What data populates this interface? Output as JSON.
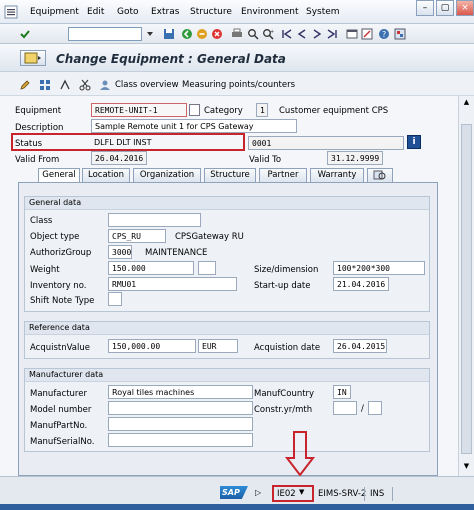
{
  "menu": {
    "items": [
      "Equipment",
      "Edit",
      "Goto",
      "Extras",
      "Structure",
      "Environment",
      "System"
    ],
    "window_buttons": {
      "minimize": "–",
      "maximize": "▢",
      "close": "×"
    }
  },
  "toolbar": {
    "command_field": {
      "value": ""
    },
    "icons": [
      "enter-icon",
      "command-dropdown-icon",
      "save-icon",
      "back-icon",
      "exit-icon",
      "cancel-icon",
      "print-icon",
      "find-icon",
      "find-next-icon",
      "first-page-icon",
      "prev-page-icon",
      "next-page-icon",
      "last-page-icon",
      "create-session-icon",
      "shortcut-icon",
      "help-icon",
      "layout-icon"
    ]
  },
  "title": {
    "text": "Change Equipment : General Data"
  },
  "appbar": {
    "class_overview": "Class overview",
    "measuring_points": "Measuring points/counters"
  },
  "header": {
    "equipment_label": "Equipment",
    "equipment_value": "REMOTE-UNIT-1",
    "category_label": "Category",
    "category_value": "1",
    "category_text": "Customer equipment CPS",
    "description_label": "Description",
    "description_value": "Sample Remote unit 1 for CPS Gateway",
    "status_label": "Status",
    "status_value": "DLFL DLT  INST",
    "status_extra": "0001",
    "valid_from_label": "Valid From",
    "valid_from_value": "26.04.2016",
    "valid_to_label": "Valid To",
    "valid_to_value": "31.12.9999"
  },
  "tabs": [
    "General",
    "Location",
    "Organization",
    "Structure",
    "Partner",
    "Warranty"
  ],
  "general_data": {
    "title": "General data",
    "class_label": "Class",
    "class_value": "",
    "object_type_label": "Object type",
    "object_type_value": "CPS_RU",
    "object_type_text": "CPSGateway RU",
    "authoriz_label": "AuthorizGroup",
    "authoriz_value": "3000",
    "authoriz_text": "MAINTENANCE",
    "weight_label": "Weight",
    "weight_value": "150.000",
    "size_label": "Size/dimension",
    "size_value": "100*200*300",
    "inventory_label": "Inventory no.",
    "inventory_value": "RMU01",
    "startup_label": "Start-up date",
    "startup_value": "21.04.2016",
    "shift_label": "Shift Note Type"
  },
  "reference_data": {
    "title": "Reference data",
    "acq_value_label": "AcquistnValue",
    "acq_value": "150,000.00",
    "currency": "EUR",
    "acq_date_label": "Acquistion date",
    "acq_date": "26.04.2015"
  },
  "manufacturer_data": {
    "title": "Manufacturer data",
    "manufacturer_label": "Manufacturer",
    "manufacturer_value": "Royal tiles machines",
    "manuf_country_label": "ManufCountry",
    "manuf_country_value": "IN",
    "model_label": "Model number",
    "constr_label": "Constr.yr/mth",
    "constr_sep": "/",
    "partno_label": "ManufPartNo.",
    "serialno_label": "ManufSerialNo."
  },
  "statusbar": {
    "sap_logo": "SAP",
    "transaction": "IE02",
    "system": "EIMS-SRV-2",
    "mode": "INS"
  },
  "colors": {
    "highlight": "#c8242b",
    "sap_blue": "#1a6fb5"
  }
}
